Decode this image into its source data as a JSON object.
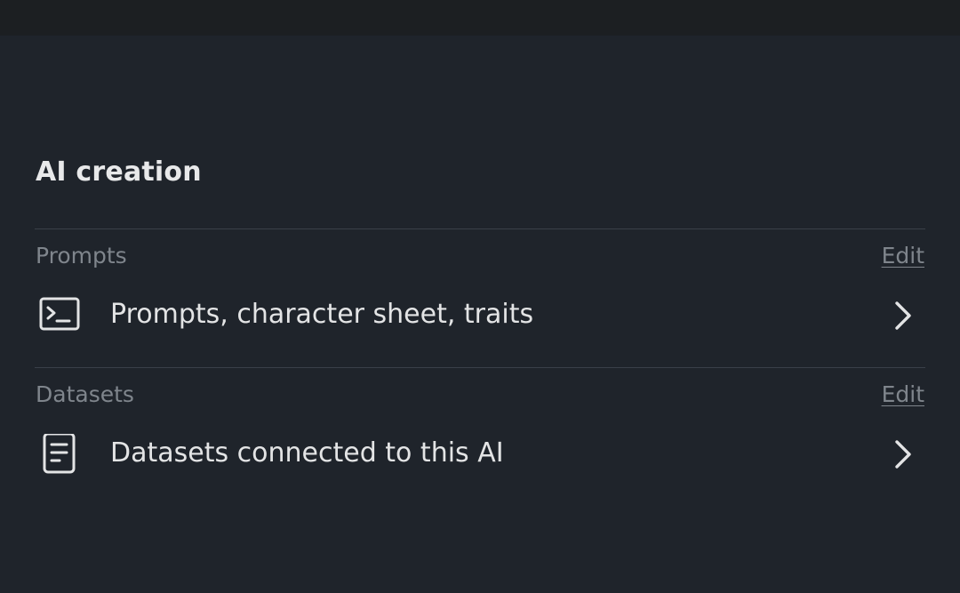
{
  "section": {
    "title": "AI creation"
  },
  "groups": [
    {
      "label": "Prompts",
      "edit_label": "Edit",
      "row_label": "Prompts, character sheet, traits",
      "icon": "terminal-icon"
    },
    {
      "label": "Datasets",
      "edit_label": "Edit",
      "row_label": "Datasets connected to this AI",
      "icon": "document-icon"
    }
  ],
  "colors": {
    "background": "#1f242b",
    "top_bar": "#1c1f22",
    "muted_text": "#7f858c",
    "primary_text": "#e3e4e5",
    "divider": "#3a4049"
  }
}
